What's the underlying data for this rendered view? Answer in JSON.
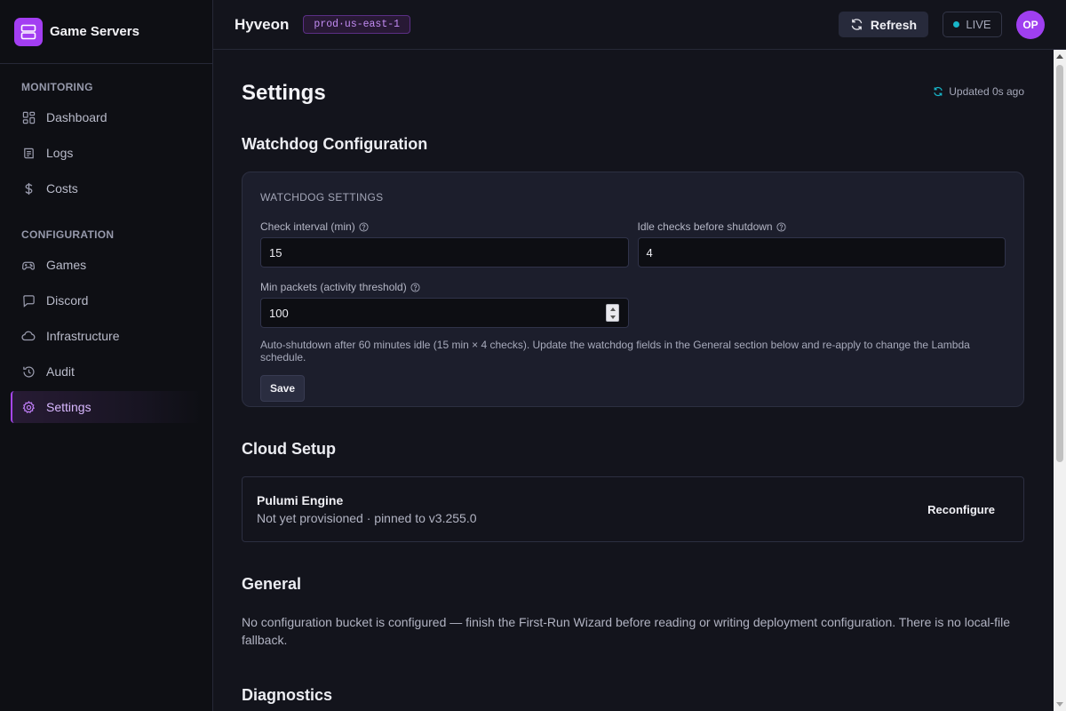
{
  "app": {
    "name": "Game Servers",
    "logo_icon": "server-stack-icon",
    "accent": "#a33ef2"
  },
  "sidebar": {
    "sections": [
      {
        "heading": "MONITORING",
        "items": [
          {
            "label": "Dashboard",
            "icon": "dashboard-icon"
          },
          {
            "label": "Logs",
            "icon": "logs-icon"
          },
          {
            "label": "Costs",
            "icon": "dollar-icon"
          }
        ]
      },
      {
        "heading": "CONFIGURATION",
        "items": [
          {
            "label": "Games",
            "icon": "gamepad-icon"
          },
          {
            "label": "Discord",
            "icon": "chat-icon"
          },
          {
            "label": "Infrastructure",
            "icon": "cloud-icon"
          },
          {
            "label": "Audit",
            "icon": "history-icon"
          },
          {
            "label": "Settings",
            "icon": "gear-icon",
            "active": true
          }
        ]
      }
    ]
  },
  "topbar": {
    "workspace": "Hyveon",
    "env_badge": "prod·us-east-1",
    "refresh_label": "Refresh",
    "live_label": "LIVE",
    "live_color": "#18b6c9",
    "avatar_initials": "OP"
  },
  "page": {
    "title": "Settings",
    "updated": "Updated 0s ago"
  },
  "watchdog": {
    "heading": "Watchdog Configuration",
    "card_label": "WATCHDOG SETTINGS",
    "check_interval": {
      "label": "Check interval (min)",
      "value": "15"
    },
    "idle_checks": {
      "label": "Idle checks before shutdown",
      "value": "4"
    },
    "min_packets": {
      "label": "Min packets (activity threshold)",
      "value": "100"
    },
    "hint": "Auto-shutdown after 60 minutes idle (15 min × 4 checks). Update the watchdog fields in the General section below and re-apply to change the Lambda schedule.",
    "save_label": "Save"
  },
  "cloud": {
    "heading": "Cloud Setup",
    "engine_name": "Pulumi Engine",
    "engine_status": "Not yet provisioned · pinned to v3.255.0",
    "reconfigure_label": "Reconfigure"
  },
  "general": {
    "heading": "General",
    "text": "No configuration bucket is configured — finish the First-Run Wizard before reading or writing deployment configuration. There is no local-file fallback."
  },
  "diagnostics": {
    "heading": "Diagnostics"
  }
}
